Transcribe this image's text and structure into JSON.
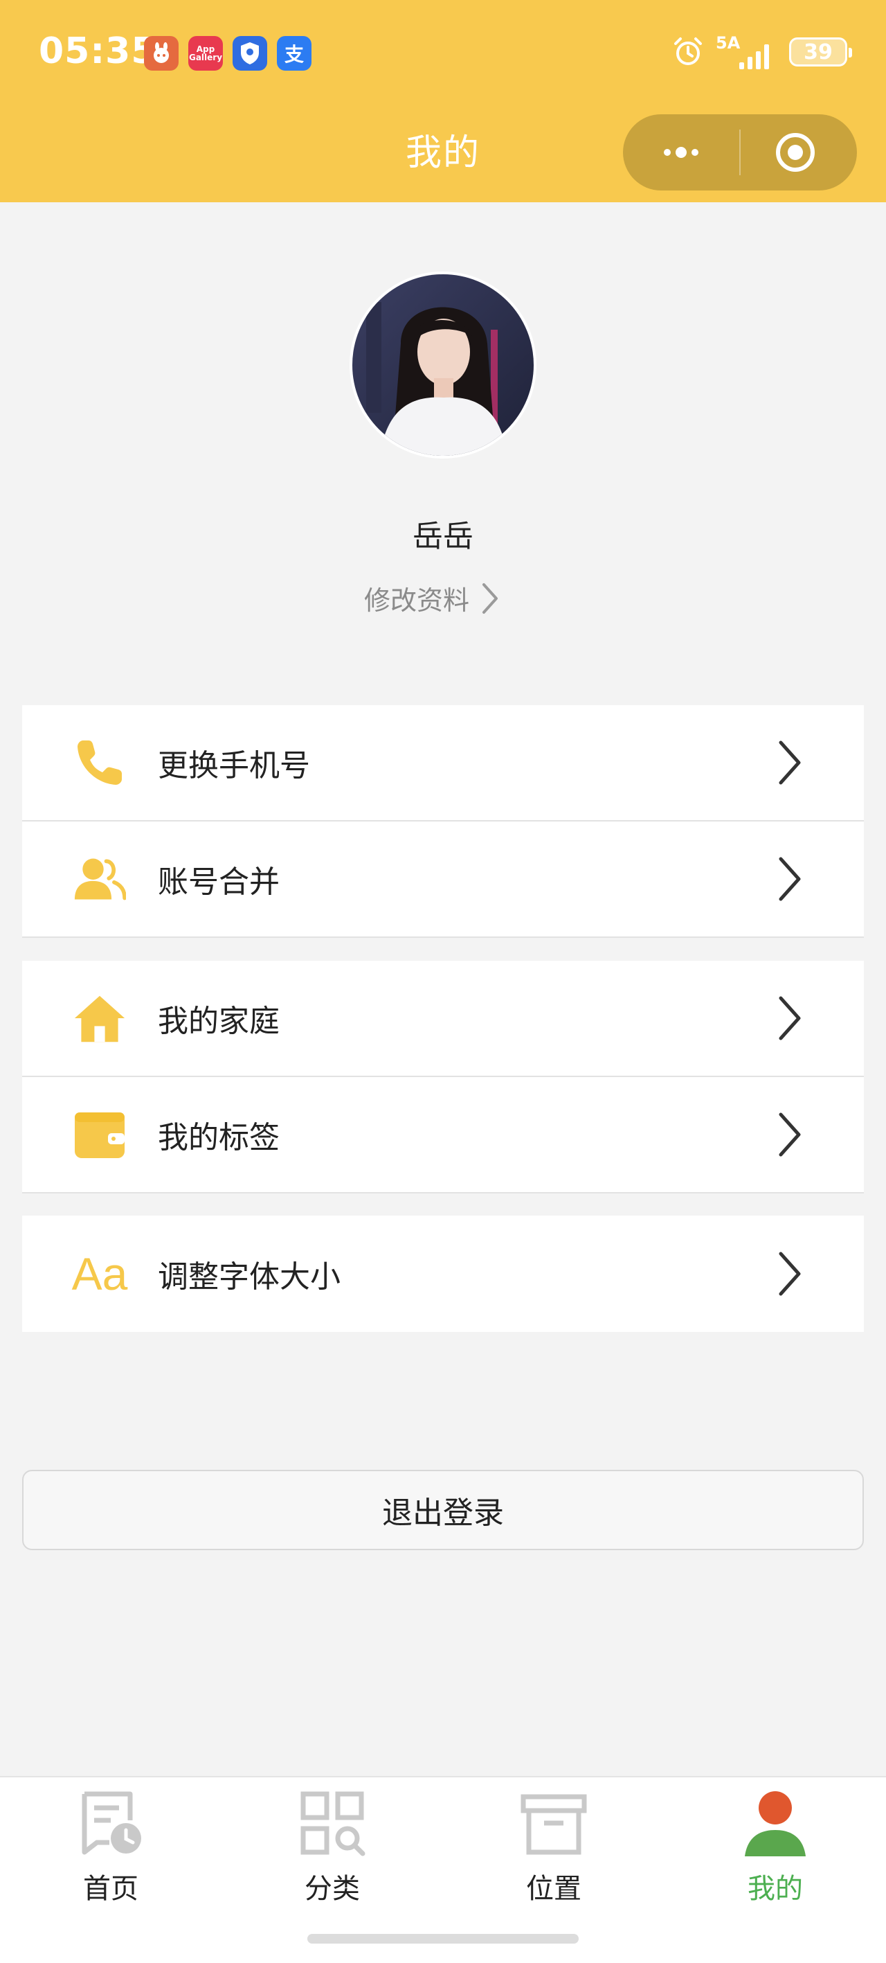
{
  "status": {
    "time": "05:35",
    "network": "5A",
    "battery": "39",
    "app_icons": [
      "rabbit-app-icon",
      "app-gallery-icon",
      "shield-app-icon",
      "alipay-icon"
    ],
    "app_gallery_text": "App Gallery",
    "alipay_text": "支"
  },
  "header": {
    "title": "我的"
  },
  "profile": {
    "name": "岳岳",
    "edit_label": "修改资料"
  },
  "menu": {
    "groups": [
      [
        {
          "label": "更换手机号",
          "icon": "phone-icon"
        },
        {
          "label": "账号合并",
          "icon": "users-icon"
        }
      ],
      [
        {
          "label": "我的家庭",
          "icon": "home-icon"
        },
        {
          "label": "我的标签",
          "icon": "wallet-icon"
        }
      ],
      [
        {
          "label": "调整字体大小",
          "icon": "font-size-icon",
          "icon_text": "Aa"
        }
      ]
    ]
  },
  "logout_label": "退出登录",
  "tabbar": {
    "items": [
      {
        "label": "首页",
        "icon": "home-doc-icon",
        "active": false
      },
      {
        "label": "分类",
        "icon": "category-icon",
        "active": false
      },
      {
        "label": "位置",
        "icon": "box-icon",
        "active": false
      },
      {
        "label": "我的",
        "icon": "profile-icon",
        "active": true
      }
    ]
  },
  "colors": {
    "header_bg": "#f8c94e",
    "accent_icon": "#f6c84a",
    "active_tab": "#4caf50",
    "page_bg": "#f3f3f3"
  }
}
